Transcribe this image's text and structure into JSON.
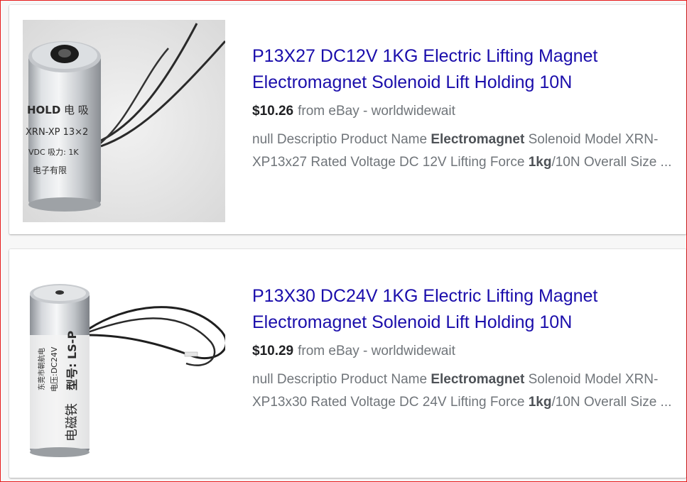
{
  "results": [
    {
      "title_line1": "P13X27 DC12V 1KG Electric Lifting Magnet",
      "title_line2": "Electromagnet Solenoid Lift Holding 10N",
      "price": "$10.26",
      "source": "from eBay - worldwidewait",
      "snippet": {
        "t1": "null Descriptio Product Name ",
        "b1": "Electromagnet",
        "t2": " Solenoid Model XRN-XP13x27 Rated Voltage DC 12V Lifting Force ",
        "b2": "1kg",
        "t3": "/10N Overall Size ..."
      },
      "image_label": {
        "brand": "HOLD",
        "cn1": "电 吸",
        "model": "XRN-XP 13×2",
        "spec": "VDC 吸力: 1K",
        "cn2": "电子有限"
      }
    },
    {
      "title_line1": "P13X30 DC24V 1KG Electric Lifting Magnet",
      "title_line2": "Electromagnet Solenoid Lift Holding 10N",
      "price": "$10.29",
      "source": "from eBay - worldwidewait",
      "snippet": {
        "t1": "null Descriptio Product Name ",
        "b1": "Electromagnet",
        "t2": " Solenoid Model XRN-XP13x30 Rated Voltage DC 24V Lifting Force ",
        "b2": "1kg",
        "t3": "/10N Overall Size ..."
      },
      "image_label": {
        "cn1": "电磁铁",
        "model": "型号: LS-P",
        "spec": "电压:DC24V",
        "cn2": "东莞市朝航电"
      }
    }
  ],
  "colors": {
    "title_link": "#1a0dab",
    "price": "#202124",
    "meta_text": "#70757a",
    "frame_border": "#e81c1c"
  }
}
